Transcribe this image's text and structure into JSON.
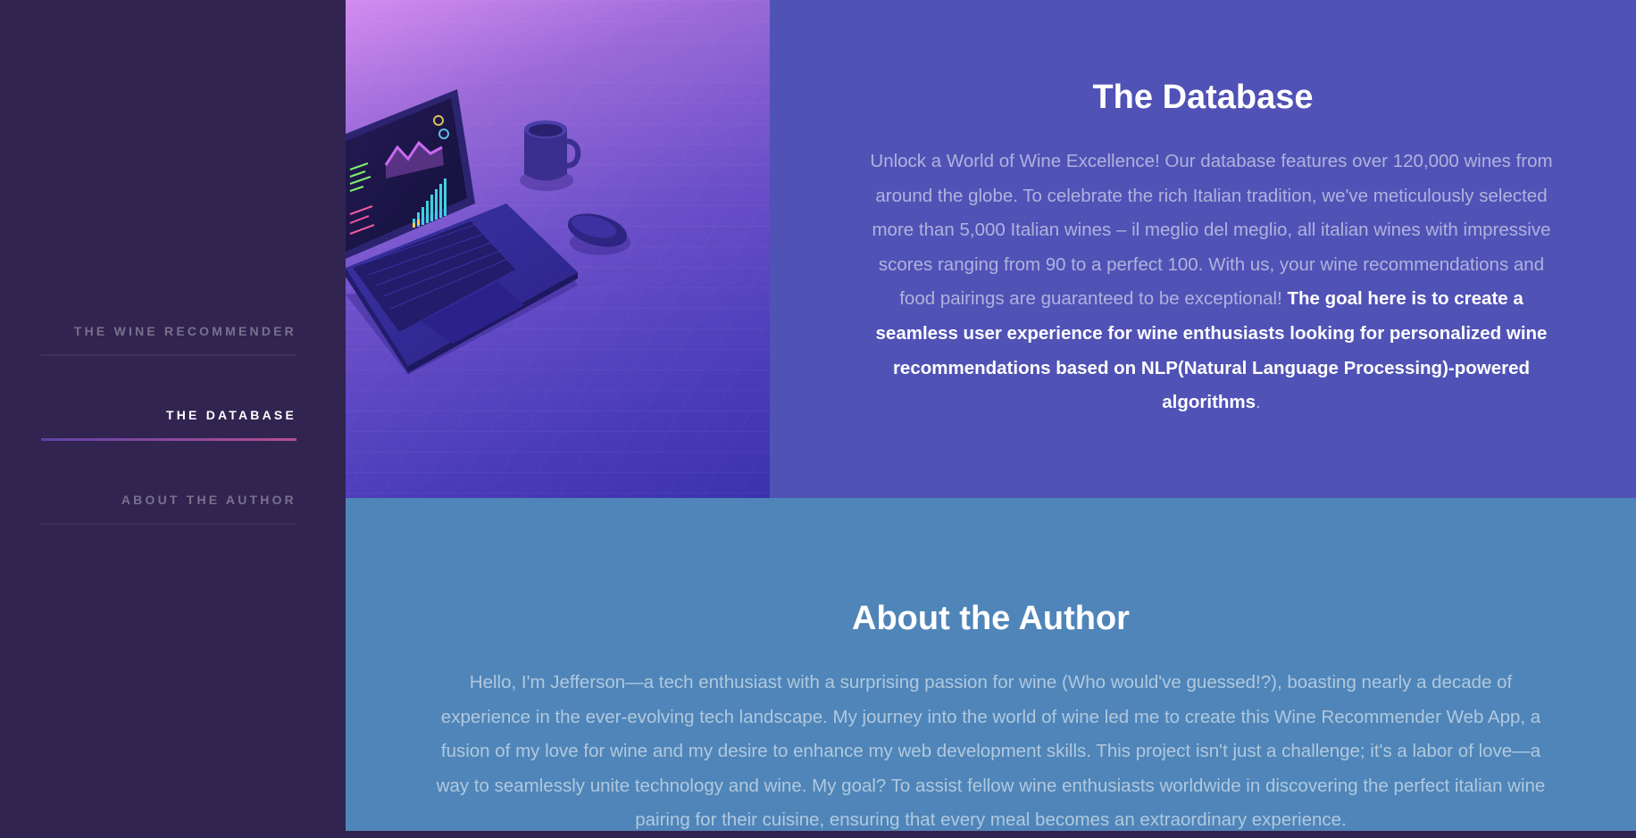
{
  "sidebar": {
    "items": [
      {
        "label": "THE WINE RECOMMENDER",
        "active": false
      },
      {
        "label": "THE DATABASE",
        "active": true
      },
      {
        "label": "ABOUT THE AUTHOR",
        "active": false
      }
    ]
  },
  "database": {
    "title": "The Database",
    "intro": "Unlock a World of Wine Excellence! Our database features over 120,000 wines from around the globe. To celebrate the rich Italian tradition, we've meticulously selected more than 5,000 Italian wines – il meglio del meglio, all italian wines with impressive scores ranging from 90 to a perfect 100. With us, your wine recommendations and food pairings are guaranteed to be exceptional!",
    "highlight": "The goal here is to create a seamless user experience for wine enthusiasts looking for personalized wine recommendations based on NLP(Natural Language Processing)-powered algorithms",
    "end": "."
  },
  "author": {
    "title": "About the Author",
    "body": "Hello, I'm Jefferson—a tech enthusiast with a surprising passion for wine (Who would've guessed!?), boasting nearly a decade of experience in the ever-evolving tech landscape. My journey into the world of wine led me to create this Wine Recommender Web App, a fusion of my love for wine and my desire to enhance my web development skills. This project isn't just a challenge; it's a labor of love—a way to seamlessly unite technology and wine. My goal? To assist fellow wine enthusiasts worldwide in discovering the perfect italian wine pairing for their cuisine, ensuring that every meal becomes an extraordinary experience."
  },
  "colors": {
    "sidebar": "#312450",
    "database_bg": "#5052b5",
    "author_bg": "#4f85b8",
    "active_underline_start": "#5e42a6",
    "active_underline_end": "#b74e91"
  },
  "icons": [
    "laptop-illustration",
    "mug-illustration",
    "mouse-illustration"
  ]
}
